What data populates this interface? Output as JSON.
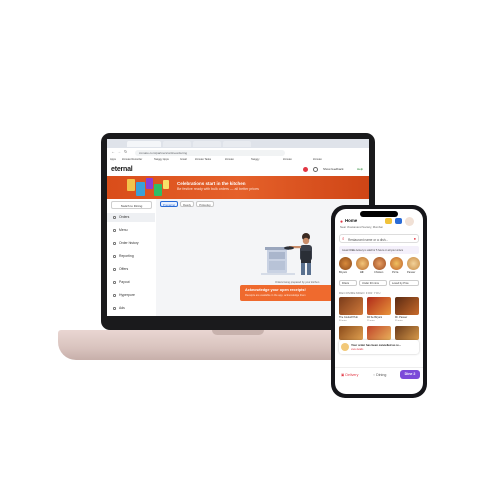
{
  "laptop": {
    "address": "zomato.com/partners/onlineordering",
    "bookmarks": [
      "Apps",
      "Zomato Recorder",
      "Swiggy Apps",
      "Gmail",
      "Zomato Tasks",
      "Zomato",
      "Swiggy",
      "Zomato",
      "Zomato"
    ],
    "logo": "eternal",
    "header_right": [
      "Show feedback",
      "Help"
    ],
    "banner": {
      "title": "Celebrations start in the kitchen",
      "subtitle": "Be festive ready with bulk orders — all better prices"
    },
    "sidebar": {
      "switch_label": "Switch to Dining",
      "items": [
        "Orders",
        "Menu",
        "Order history",
        "Reporting",
        "Offers",
        "Payout",
        "Hyperpure",
        "Ads"
      ]
    },
    "content_tabs": [
      "Preparing",
      "Ready",
      "Pickedup"
    ],
    "empty_text": "Orders being prepared by your kitchen",
    "ack": {
      "title": "Acknowledge your open receipts!",
      "subtitle": "Receipts are available in the app, acknowledge them"
    }
  },
  "phone": {
    "location_title": "Home",
    "location_sub": "Near Vivekanand Society, Mumbai",
    "search_placeholder": "Restaurant name or a dish...",
    "promo": "Great FREE delivery is valid for 5 hours on all your orders",
    "categories": [
      "Biryani",
      "All",
      "Chicken",
      "Pizza",
      "Paneer"
    ],
    "filters": [
      "Filters",
      "Under 30 mins",
      "Loved by Pros"
    ],
    "section_title": "RECOMMENDED FOR YOU",
    "cards_row1": [
      {
        "name": "The Cookoff Hub",
        "meta": "30 mins"
      },
      {
        "name": "Dil Se Biryani",
        "meta": "25 mins"
      },
      {
        "name": "Mr. Paneer",
        "meta": "35 mins"
      }
    ],
    "cards_row2": [
      {
        "name": "Food Home",
        "meta": "20 mins"
      },
      {
        "name": "Pizza House",
        "meta": "30 mins"
      },
      {
        "name": "Grill Box",
        "meta": "40 mins"
      }
    ],
    "toast": {
      "title": "Your order has been cancelled as re...",
      "link": "view details"
    },
    "bottom_tabs": [
      "Delivery",
      "Dining"
    ],
    "dining_cta": "Dine 2"
  },
  "colors": {
    "brand_orange": "#e5612a",
    "active_blue": "#2a6bd6",
    "zomato_red": "#e23744",
    "dining_purple": "#7b4ad9"
  }
}
